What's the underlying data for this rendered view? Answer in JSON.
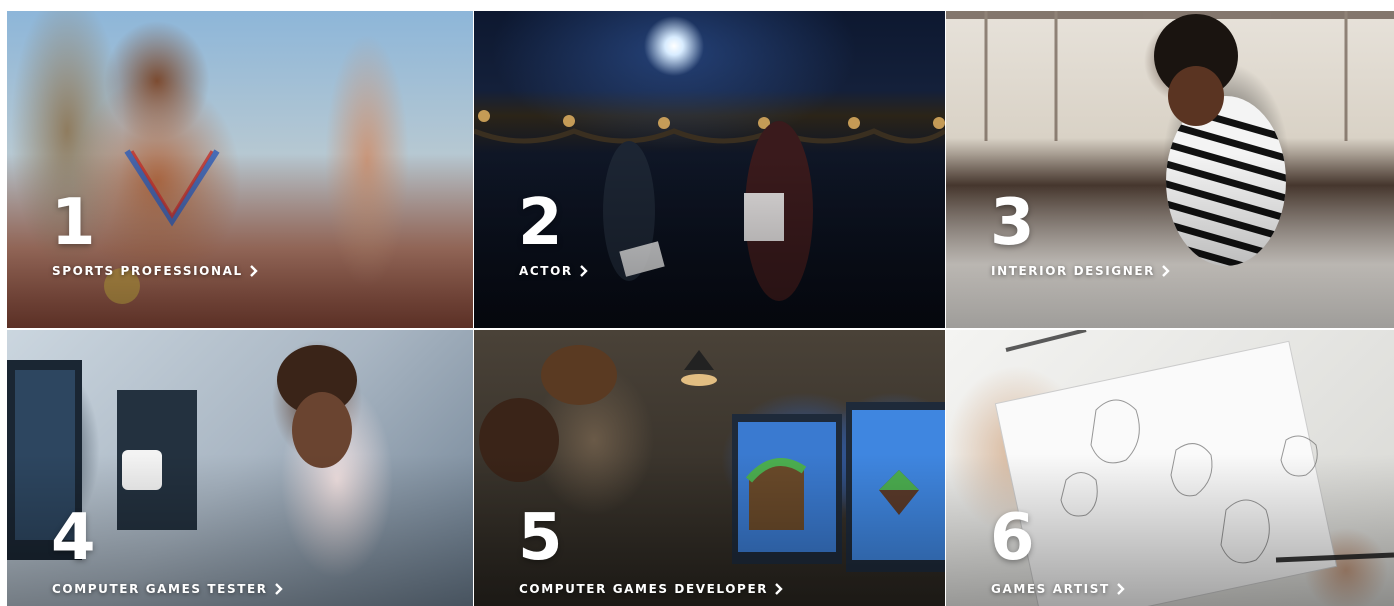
{
  "tiles": [
    {
      "number": "1",
      "label": "SPORTS PROFESSIONAL",
      "chevron_icon": "chevron-right-icon"
    },
    {
      "number": "2",
      "label": "ACTOR",
      "chevron_icon": "chevron-right-icon"
    },
    {
      "number": "3",
      "label": "INTERIOR DESIGNER",
      "chevron_icon": "chevron-right-icon"
    },
    {
      "number": "4",
      "label": "COMPUTER GAMES TESTER",
      "chevron_icon": "chevron-right-icon"
    },
    {
      "number": "5",
      "label": "COMPUTER GAMES DEVELOPER",
      "chevron_icon": "chevron-right-icon"
    },
    {
      "number": "6",
      "label": "GAMES ARTIST",
      "chevron_icon": "chevron-right-icon"
    }
  ],
  "colors": {
    "text": "#ffffff"
  }
}
